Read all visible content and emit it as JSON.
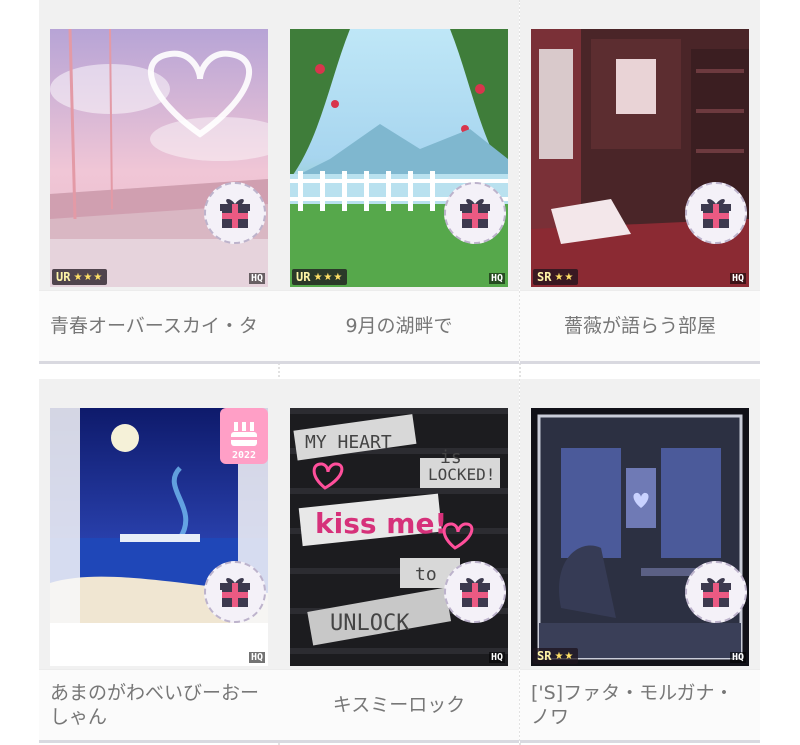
{
  "items": [
    {
      "name": "青春オーバースカイ・タ",
      "rarity": "UR",
      "stars": "★★★",
      "hq": "HQ",
      "theme": "sky-heart"
    },
    {
      "name": "9月の湖畔で",
      "rarity": "UR",
      "stars": "★★★",
      "hq": "HQ",
      "theme": "lake"
    },
    {
      "name": "薔薇が語らう部屋",
      "rarity": "SR",
      "stars": "★★",
      "hq": "HQ",
      "theme": "rose-room"
    },
    {
      "name": "あまのがわべいびーおーしゃん",
      "rarity": "",
      "stars": "",
      "hq": "HQ",
      "theme": "night-ocean",
      "badge_year": "2022"
    },
    {
      "name": "キスミーロック",
      "rarity": "",
      "stars": "",
      "hq": "HQ",
      "theme": "kiss-rock"
    },
    {
      "name": "['S]ファタ・モルガナ・ノワ",
      "rarity": "SR",
      "stars": "★★",
      "hq": "HQ",
      "theme": "noir-room"
    }
  ],
  "art_text": {
    "heart_notes": [
      "MY HEART",
      "is",
      "LOCKED!",
      "kiss me!",
      "to",
      "UNLOCK"
    ]
  },
  "colors": {
    "gift_pink": "#ea5a83",
    "gift_dark": "#3d3a4f",
    "badge_pink": "#ff9fc6"
  }
}
